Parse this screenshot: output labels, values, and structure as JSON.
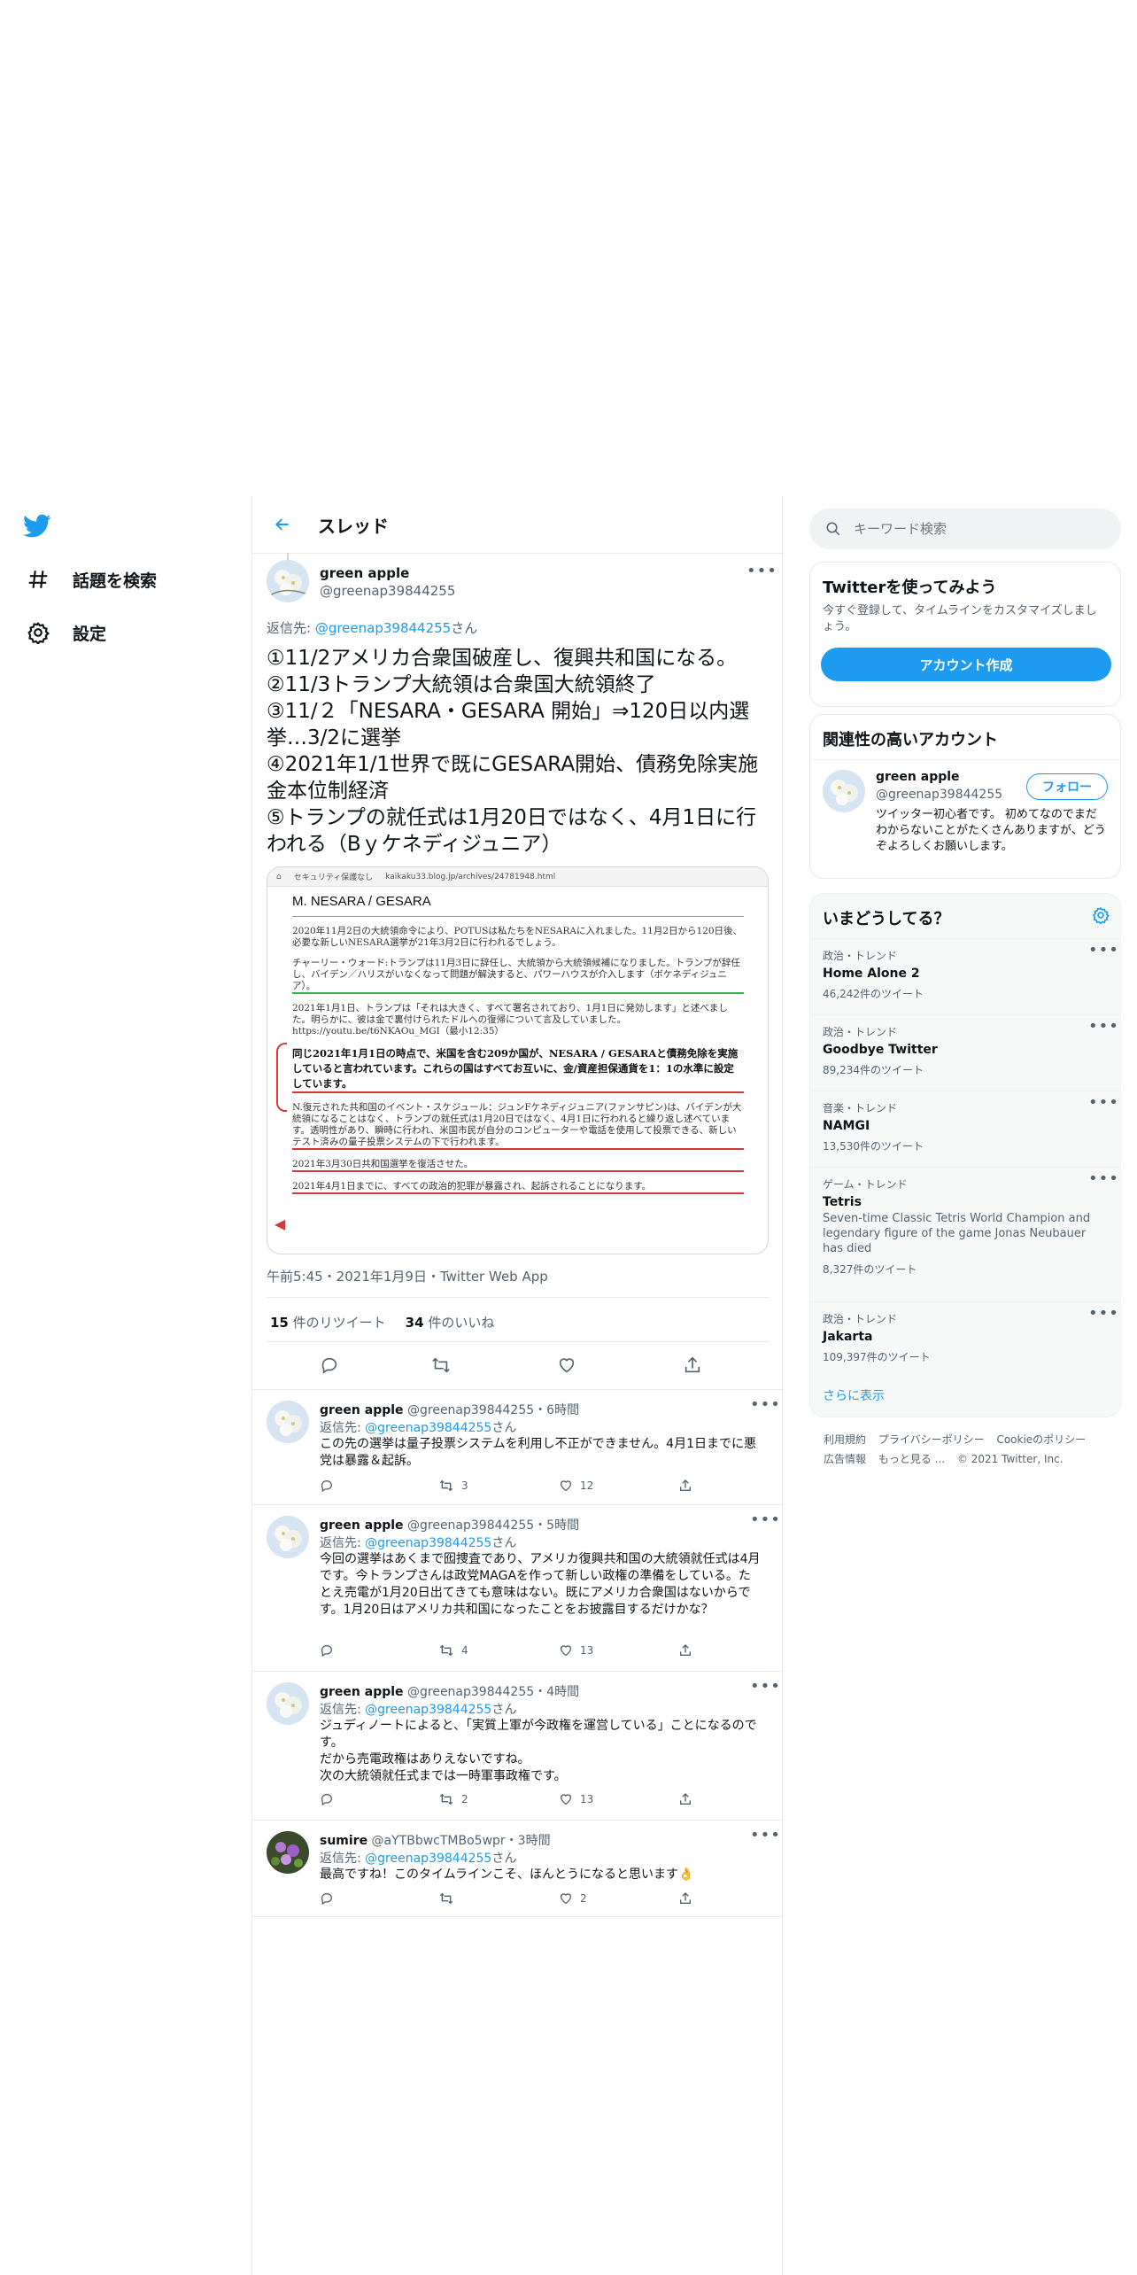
{
  "nav": {
    "explore_label": "話題を検索",
    "settings_label": "設定"
  },
  "thread": {
    "header_title": "スレッド",
    "main_tweet": {
      "name": "green apple",
      "handle": "@greenap39844255",
      "reply_to_prefix": "返信先: ",
      "reply_to_handle": "@greenap39844255",
      "reply_to_suffix": "さん",
      "text": "①11/2アメリカ合衆国破産し、復興共和国になる。\n②11/3トランプ大統領は合衆国大統領終了\n③11/２「NESARA・GESARA 開始」⇒120日以内選挙…3/2に選挙\n④2021年1/1世界で既にGESARA開始、債務免除実施金本位制経済\n⑤トランプの就任式は1月20日ではなく、4月1日に行われる（Bｙケネディジュニア）",
      "timestamp": "午前5:45・2021年1月9日・Twitter Web App",
      "retweets_count": "15",
      "retweets_label": "件のリツイート",
      "likes_count": "34",
      "likes_label": "件のいいね"
    },
    "media": {
      "browser_security": "セキュリティ保護なし",
      "browser_url": "kaikaku33.blog.jp/archives/24781948.html",
      "heading": "M. NESARA / GESARA",
      "p1": "2020年11月2日の大統領命令により、POTUSは私たちをNESARAに入れました。11月2日から120日後、必要な新しいNESARA選挙が21年3月2日に行われるでしょう。",
      "p2": "チャーリー・ウォード:トランプは11月3日に辞任し、大統領から大統領候補になりました。トランプが辞任し、バイデン／ハリスがいなくなって問題が解決すると、パワーハウスが介入します（ボケネディジュニア）。",
      "p3": "2021年1月1日、トランプは「それは大きく、すべて署名されており、1月1日に発効します」と述べました。明らかに、彼は金で裏付けられたドルへの復帰について言及していました。https://youtu.be/t6NKAOu_MGI（最小12:35）",
      "p4": "同じ2021年1月1日の時点で、米国を含む209か国が、NESARA / GESARAと債務免除を実施していると言われています。これらの国はすべてお互いに、金/資産担保通貨を1：1の水準に設定しています。",
      "p5": "N.復元された共和国のイベント・スケジュール：ジュンFケネディジュニア(ファンサピン)は、バイデンが大統領になることはなく、トランプの就任式は1月20日ではなく、4月1日に行われると繰り返し述べています。透明性があり、瞬時に行われ、米国市民が自分のコンピューターや電話を使用して投票できる、新しいテスト済みの量子投票システムの下で行われます。",
      "p6": "2021年3月30日共和国選挙を復活させた。",
      "p7": "2021年4月1日までに、すべての政治的犯罪が暴露され、起訴されることになります。"
    },
    "replies": [
      {
        "name": "green apple",
        "handle": "@greenap39844255",
        "time": "・6時間",
        "reply_to_prefix": "返信先: ",
        "reply_to_handle": "@greenap39844255",
        "reply_to_suffix": "さん",
        "text": "この先の選挙は量子投票システムを利用し不正ができません。4月1日までに悪党は暴露＆起訴。",
        "retweets": "3",
        "likes": "12"
      },
      {
        "name": "green apple",
        "handle": "@greenap39844255",
        "time": "・5時間",
        "reply_to_prefix": "返信先: ",
        "reply_to_handle": "@greenap39844255",
        "reply_to_suffix": "さん",
        "text": "今回の選挙はあくまで囮捜査であり、アメリカ復興共和国の大統領就任式は4月です。今トランプさんは政党MAGAを作って新しい政権の準備をしている。たとえ売電が1月20日出てきても意味はない。既にアメリカ合衆国はないからです。1月20日はアメリカ共和国になったことをお披露目するだけかな？",
        "retweets": "4",
        "likes": "13"
      },
      {
        "name": "green apple",
        "handle": "@greenap39844255",
        "time": "・4時間",
        "reply_to_prefix": "返信先: ",
        "reply_to_handle": "@greenap39844255",
        "reply_to_suffix": "さん",
        "text": "ジュディノートによると、「実質上軍が今政権を運営している」ことになるのです。\nだから売電政権はありえないですね。\n次の大統領就任式までは一時軍事政権です。",
        "retweets": "2",
        "likes": "13"
      },
      {
        "name": "sumire",
        "handle": "@aYTBbwcTMBo5wpr",
        "time": "・3時間",
        "reply_to_prefix": "返信先: ",
        "reply_to_handle": "@greenap39844255",
        "reply_to_suffix": "さん",
        "text": "最高ですね！このタイムラインこそ、ほんとうになると思います👌",
        "retweets": "",
        "likes": "2"
      }
    ]
  },
  "sidebar": {
    "search_placeholder": "キーワード検索",
    "signup": {
      "title": "Twitterを使ってみよう",
      "desc": "今すぐ登録して、タイムラインをカスタマイズしましょう。",
      "button": "アカウント作成"
    },
    "relevant": {
      "title": "関連性の高いアカウント",
      "name": "green apple",
      "handle": "@greenap39844255",
      "follow": "フォロー",
      "bio": "ツイッター初心者です。 初めてなのでまだわからないことがたくさんありますが、どうぞよろしくお願いします。"
    },
    "trends": {
      "title": "いまどうしてる？",
      "items": [
        {
          "category": "政治・トレンド",
          "name": "Home Alone 2",
          "desc": "",
          "count": "46,242件のツイート"
        },
        {
          "category": "政治・トレンド",
          "name": "Goodbye Twitter",
          "desc": "",
          "count": "89,234件のツイート"
        },
        {
          "category": "音楽・トレンド",
          "name": "NAMGI",
          "desc": "",
          "count": "13,530件のツイート"
        },
        {
          "category": "ゲーム・トレンド",
          "name": "Tetris",
          "desc": "Seven-time Classic Tetris World Champion and legendary figure of the game Jonas Neubauer has died",
          "count": "8,327件のツイート"
        },
        {
          "category": "政治・トレンド",
          "name": "Jakarta",
          "desc": "",
          "count": "109,397件のツイート"
        }
      ],
      "show_more": "さらに表示"
    },
    "footer": {
      "terms": "利用規約",
      "privacy": "プライバシーポリシー",
      "cookie": "Cookieのポリシー",
      "ads": "広告情報",
      "more": "もっと見る ...",
      "copyright": "© 2021 Twitter, Inc."
    }
  },
  "colors": {
    "accent": "#1d9bf0",
    "text": "#0f1419",
    "muted": "#536471"
  }
}
